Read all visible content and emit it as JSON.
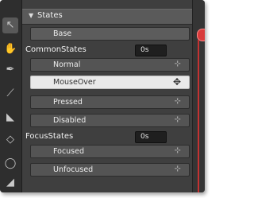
{
  "panel": {
    "title": "States"
  },
  "states": {
    "base_label": "Base",
    "groups": [
      {
        "name": "CommonStates",
        "transition_duration": "0s",
        "items": [
          {
            "label": "Normal",
            "selected": false
          },
          {
            "label": "MouseOver",
            "selected": true
          },
          {
            "label": "Pressed",
            "selected": false
          },
          {
            "label": "Disabled",
            "selected": false
          }
        ]
      },
      {
        "name": "FocusStates",
        "transition_duration": "0s",
        "items": [
          {
            "label": "Focused",
            "selected": false
          },
          {
            "label": "Unfocused",
            "selected": false
          }
        ]
      }
    ]
  },
  "toolbar": {
    "tools": [
      "selection-tool",
      "pan-tool",
      "pen-tool",
      "brush-tool",
      "paint-bucket-tool",
      "eraser-tool",
      "shape-tool"
    ]
  },
  "colors": {
    "panel_bg": "#3f3f3f",
    "row_bg": "#545454",
    "selected_row_bg": "#e9e9e9",
    "recording_indicator": "#d83a3a"
  }
}
